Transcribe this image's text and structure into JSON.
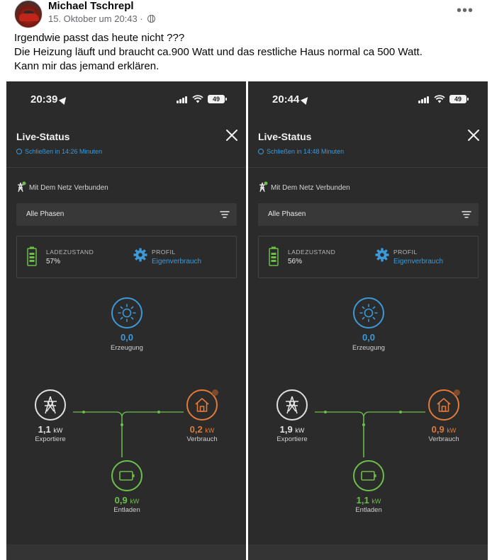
{
  "post": {
    "author": "Michael Tschrepl",
    "date": "15. Oktober um 20:43 ·",
    "more_icon": "more-dots-icon",
    "lines": [
      "Irgendwie passt das heute nicht ???",
      "Die Heizung läuft und braucht ca.900 Watt und das restliche Haus normal ca 500 Watt.",
      "Kann mir das jemand erklären."
    ]
  },
  "screens": [
    {
      "time": "20:39",
      "battery_pct": "49",
      "title": "Live-Status",
      "subtitle": "Schließen in 14:26 Minuten",
      "grid_status": "Mit Dem Netz Verbunden",
      "phase_select": "Alle Phasen",
      "charge_label": "LADEZUSTAND",
      "charge_value": "57%",
      "profile_label": "PROFIL",
      "profile_value": "Eigenverbrauch",
      "production_value": "0,0",
      "production_label": "Erzeugung",
      "grid_value": "1,1",
      "grid_unit": "kW",
      "grid_label": "Exportiere",
      "home_value": "0,2",
      "home_unit": "kW",
      "home_label": "Verbrauch",
      "battery_value": "0,9",
      "battery_unit": "kW",
      "battery_label": "Entladen"
    },
    {
      "time": "20:44",
      "battery_pct": "49",
      "title": "Live-Status",
      "subtitle": "Schließen in 14:48 Minuten",
      "grid_status": "Mit Dem Netz Verbunden",
      "phase_select": "Alle Phasen",
      "charge_label": "LADEZUSTAND",
      "charge_value": "56%",
      "profile_label": "PROFIL",
      "profile_value": "Eigenverbrauch",
      "production_value": "0,0",
      "production_label": "Erzeugung",
      "grid_value": "1,9",
      "grid_unit": "kW",
      "grid_label": "Exportiere",
      "home_value": "0,9",
      "home_unit": "kW",
      "home_label": "Verbrauch",
      "battery_value": "1,1",
      "battery_unit": "kW",
      "battery_label": "Entladen"
    }
  ],
  "colors": {
    "solar": "#3b9ad8",
    "grid": "#e0e0e0",
    "home": "#e07b39",
    "battery": "#6cc04a",
    "flow_line": "#6cc04a",
    "background": "#2b2b2c"
  }
}
